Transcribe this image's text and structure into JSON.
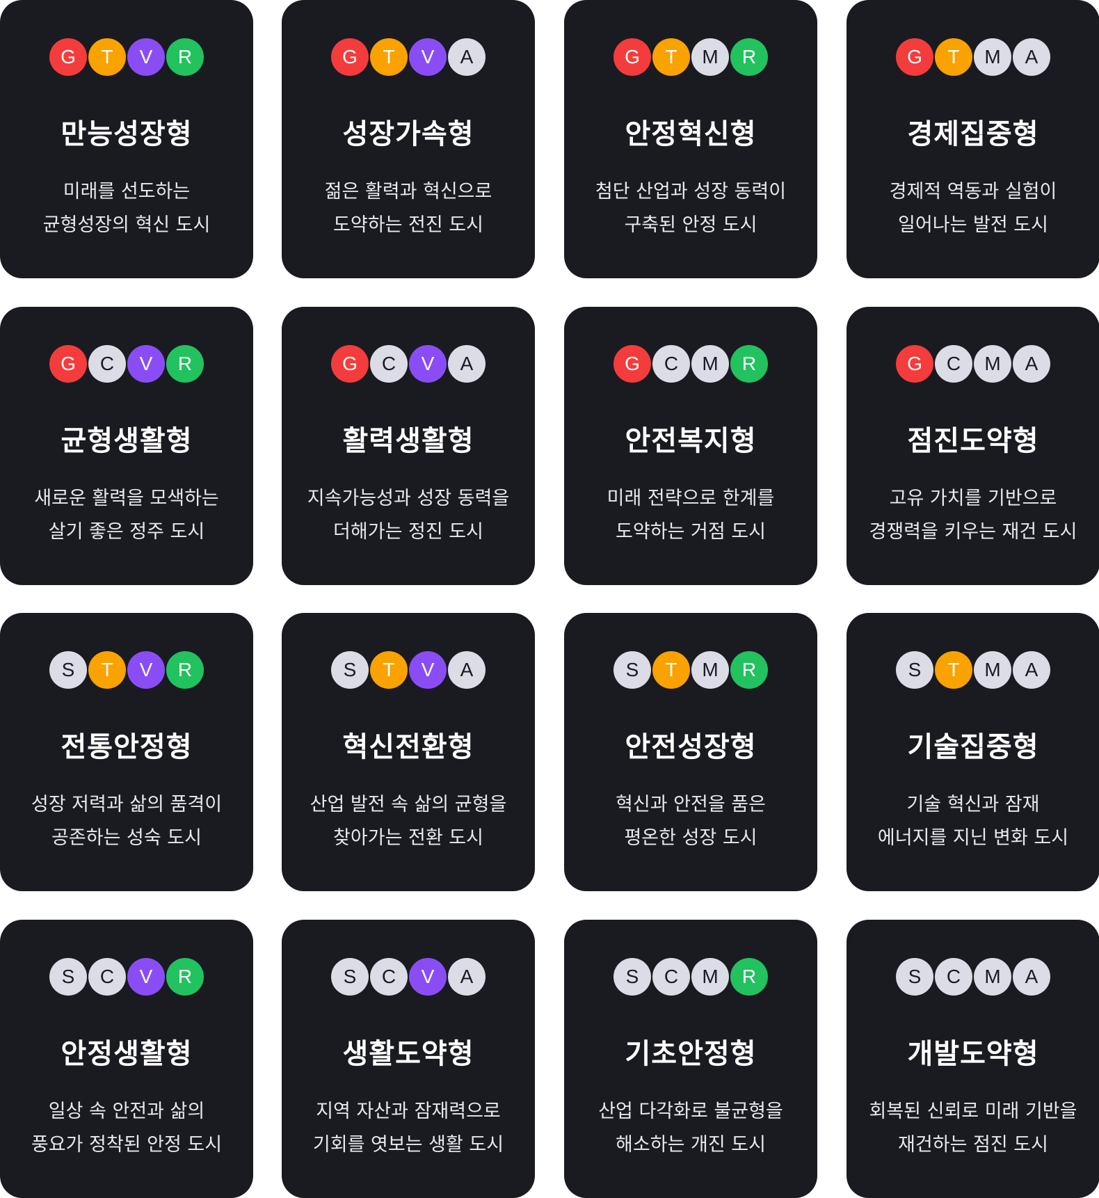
{
  "colors": {
    "G": "#f43c3c",
    "T": "#f9a200",
    "V": "#8a4df5",
    "R": "#22c25e",
    "neutral": "#dcdce6",
    "card_bg": "#1a1b21"
  },
  "cards": [
    {
      "badges": [
        "G",
        "T",
        "V",
        "R"
      ],
      "title": "만능성장형",
      "line1": "미래를 선도하는",
      "line2": "균형성장의 혁신 도시"
    },
    {
      "badges": [
        "G",
        "T",
        "V",
        "A"
      ],
      "title": "성장가속형",
      "line1": "젊은 활력과 혁신으로",
      "line2": "도약하는 전진 도시"
    },
    {
      "badges": [
        "G",
        "T",
        "M",
        "R"
      ],
      "title": "안정혁신형",
      "line1": "첨단 산업과 성장 동력이",
      "line2": "구축된 안정 도시"
    },
    {
      "badges": [
        "G",
        "T",
        "M",
        "A"
      ],
      "title": "경제집중형",
      "line1": "경제적 역동과 실험이",
      "line2": "일어나는 발전 도시"
    },
    {
      "badges": [
        "G",
        "C",
        "V",
        "R"
      ],
      "title": "균형생활형",
      "line1": "새로운 활력을 모색하는",
      "line2": "살기 좋은 정주 도시"
    },
    {
      "badges": [
        "G",
        "C",
        "V",
        "A"
      ],
      "title": "활력생활형",
      "line1": "지속가능성과 성장 동력을",
      "line2": "더해가는 정진 도시"
    },
    {
      "badges": [
        "G",
        "C",
        "M",
        "R"
      ],
      "title": "안전복지형",
      "line1": "미래 전략으로 한계를",
      "line2": "도약하는 거점 도시"
    },
    {
      "badges": [
        "G",
        "C",
        "M",
        "A"
      ],
      "title": "점진도약형",
      "line1": "고유 가치를 기반으로",
      "line2": "경쟁력을 키우는 재건 도시"
    },
    {
      "badges": [
        "S",
        "T",
        "V",
        "R"
      ],
      "title": "전통안정형",
      "line1": "성장 저력과 삶의 품격이",
      "line2": "공존하는 성숙 도시"
    },
    {
      "badges": [
        "S",
        "T",
        "V",
        "A"
      ],
      "title": "혁신전환형",
      "line1": "산업 발전 속 삶의 균형을",
      "line2": "찾아가는 전환 도시"
    },
    {
      "badges": [
        "S",
        "T",
        "M",
        "R"
      ],
      "title": "안전성장형",
      "line1": "혁신과 안전을 품은",
      "line2": "평온한 성장 도시"
    },
    {
      "badges": [
        "S",
        "T",
        "M",
        "A"
      ],
      "title": "기술집중형",
      "line1": "기술 혁신과 잠재",
      "line2": "에너지를 지닌 변화 도시"
    },
    {
      "badges": [
        "S",
        "C",
        "V",
        "R"
      ],
      "title": "안정생활형",
      "line1": "일상 속 안전과 삶의",
      "line2": "풍요가 정착된 안정 도시"
    },
    {
      "badges": [
        "S",
        "C",
        "V",
        "A"
      ],
      "title": "생활도약형",
      "line1": "지역 자산과 잠재력으로",
      "line2": "기회를 엿보는 생활 도시"
    },
    {
      "badges": [
        "S",
        "C",
        "M",
        "R"
      ],
      "title": "기초안정형",
      "line1": "산업 다각화로 불균형을",
      "line2": "해소하는 개진 도시"
    },
    {
      "badges": [
        "S",
        "C",
        "M",
        "A"
      ],
      "title": "개발도약형",
      "line1": "회복된 신뢰로 미래 기반을",
      "line2": "재건하는 점진 도시"
    }
  ]
}
